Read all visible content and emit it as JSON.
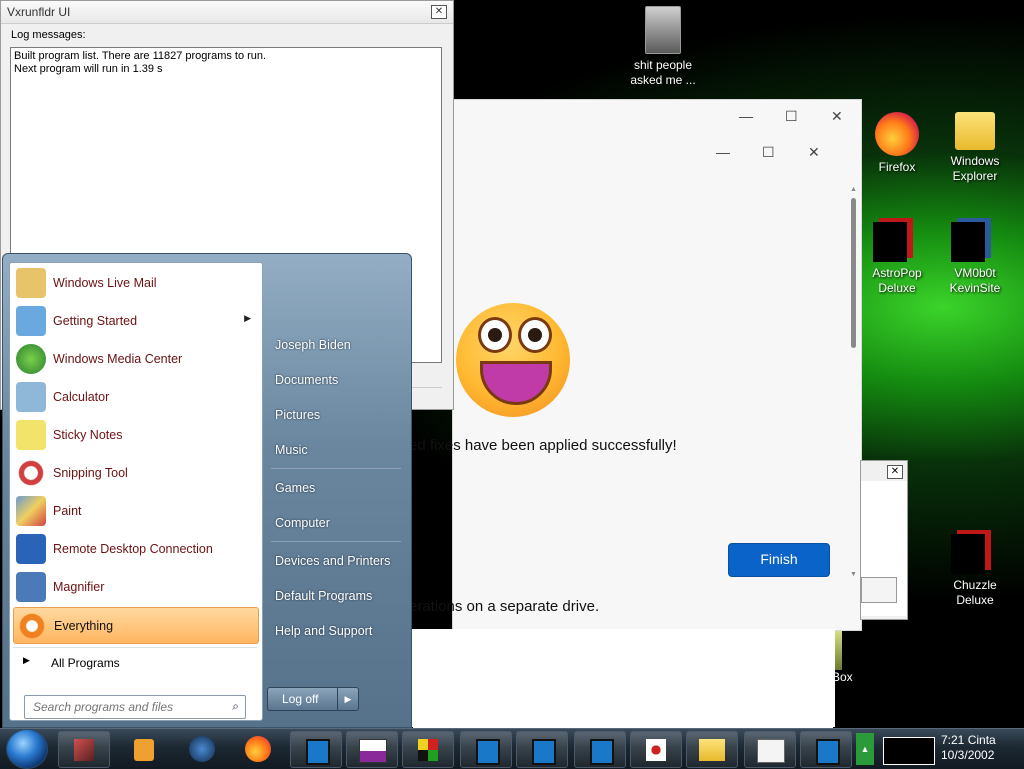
{
  "vx_window": {
    "title": "Vxrunfldr UI",
    "close": "✕",
    "log_label": "Log messages:",
    "log_lines": [
      "Built program list. There are 11827 programs to run.",
      "Next program will run in 1.39 s"
    ]
  },
  "fix_window": {
    "message": "ed fixes have been applied successfully!",
    "message2": "erations on a separate drive.",
    "finish_label": "Finish",
    "min": "—",
    "max": "☐",
    "close": "✕"
  },
  "desktop": {
    "icons": [
      {
        "label": "shit people asked me ...",
        "icon": "document-folder-icon"
      },
      {
        "label": "Firefox",
        "icon": "firefox-icon"
      },
      {
        "label": "Windows Explorer",
        "icon": "folder-icon"
      },
      {
        "label": "AstroPop Deluxe",
        "icon": "astropop-icon"
      },
      {
        "label": "VM0b0t KevinSite",
        "icon": "vmbot-icon"
      },
      {
        "label": "Chuzzle Deluxe",
        "icon": "chuzzle-icon"
      },
      {
        "label": "Box",
        "icon": "box-icon"
      }
    ]
  },
  "start_menu": {
    "programs": [
      {
        "label": "Windows Live Mail",
        "icon": "mail-icon",
        "color": "#e7c36a"
      },
      {
        "label": "Getting Started",
        "icon": "getting-started-icon",
        "color": "#6aa9e0",
        "submenu": true
      },
      {
        "label": "Windows Media Center",
        "icon": "media-center-icon",
        "color": "#3aa040"
      },
      {
        "label": "Calculator",
        "icon": "calculator-icon",
        "color": "#8fb8d8"
      },
      {
        "label": "Sticky Notes",
        "icon": "sticky-notes-icon",
        "color": "#f2e46a"
      },
      {
        "label": "Snipping Tool",
        "icon": "scissors-icon",
        "color": "#d04040"
      },
      {
        "label": "Paint",
        "icon": "paint-icon",
        "color": "#6a9ad0"
      },
      {
        "label": "Remote Desktop Connection",
        "icon": "remote-desktop-icon",
        "color": "#2a64b8"
      },
      {
        "label": "Magnifier",
        "icon": "magnifier-icon",
        "color": "#4a7ab8"
      },
      {
        "label": "Everything",
        "icon": "everything-icon",
        "color": "#f08020"
      }
    ],
    "all_programs": "All Programs",
    "search_placeholder": "Search programs and files",
    "right_items": [
      "Joseph Biden",
      "Documents",
      "Pictures",
      "Music",
      "Games",
      "Computer",
      "Devices and Printers",
      "Default Programs",
      "Help and Support"
    ],
    "logoff_label": "Log off",
    "logoff_arrow": "▶"
  },
  "taskbar": {
    "clock_time": "7:21 Cinta",
    "clock_date": "10/3/2002"
  }
}
